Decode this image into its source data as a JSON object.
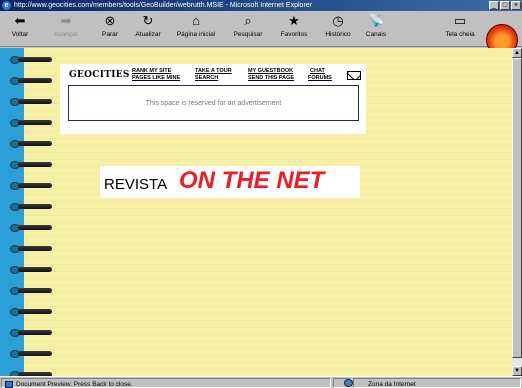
{
  "window": {
    "title": "http://www.geocities.com/members/tools/GeoBuilder/webrutth.MSIE - Microsoft Internet Explorer",
    "controls": [
      "_",
      "□",
      "×"
    ]
  },
  "toolbar": {
    "buttons": [
      {
        "label": "Voltar",
        "icon": "back-arrow-icon",
        "enabled": true
      },
      {
        "label": "Avançar",
        "icon": "forward-arrow-icon",
        "enabled": false
      },
      {
        "label": "Parar",
        "icon": "stop-icon",
        "enabled": true
      },
      {
        "label": "Atualizar",
        "icon": "refresh-icon",
        "enabled": true
      },
      {
        "label": "Página inicial",
        "icon": "home-icon",
        "enabled": true
      },
      {
        "label": "Pesquisar",
        "icon": "search-icon",
        "enabled": true
      },
      {
        "label": "Favoritos",
        "icon": "favorites-icon",
        "enabled": true
      },
      {
        "label": "Histórico",
        "icon": "history-icon",
        "enabled": true
      },
      {
        "label": "Canais",
        "icon": "channels-icon",
        "enabled": true
      },
      {
        "label": "Tela cheia",
        "icon": "fullscreen-icon",
        "enabled": true
      }
    ]
  },
  "geocities": {
    "logo": "GEOCITIES",
    "links": {
      "rank_my_site": "RANK MY SITE",
      "pages_like_mine": "PAGES LIKE MINE",
      "take_a_tour": "TAKE A TOUR",
      "search": "SEARCH",
      "my_guestbook": "MY GUESTBOOK",
      "send_this_page": "SEND THIS PAGE",
      "chat": "CHAT",
      "forums": "FORUMS"
    },
    "ad_text": "This space is reserved for an advertisement"
  },
  "content": {
    "revista": "REVISTA",
    "title": "ON THE NET"
  },
  "statusbar": {
    "message": "Document Preview.  Press Back to close.",
    "zone": "Zona da Internet"
  },
  "colors": {
    "title_red": "#ee1c25",
    "page_yellow": "#f6efa6",
    "spine_blue": "#2aa0d6",
    "titlebar_blue": "#0a246a"
  }
}
